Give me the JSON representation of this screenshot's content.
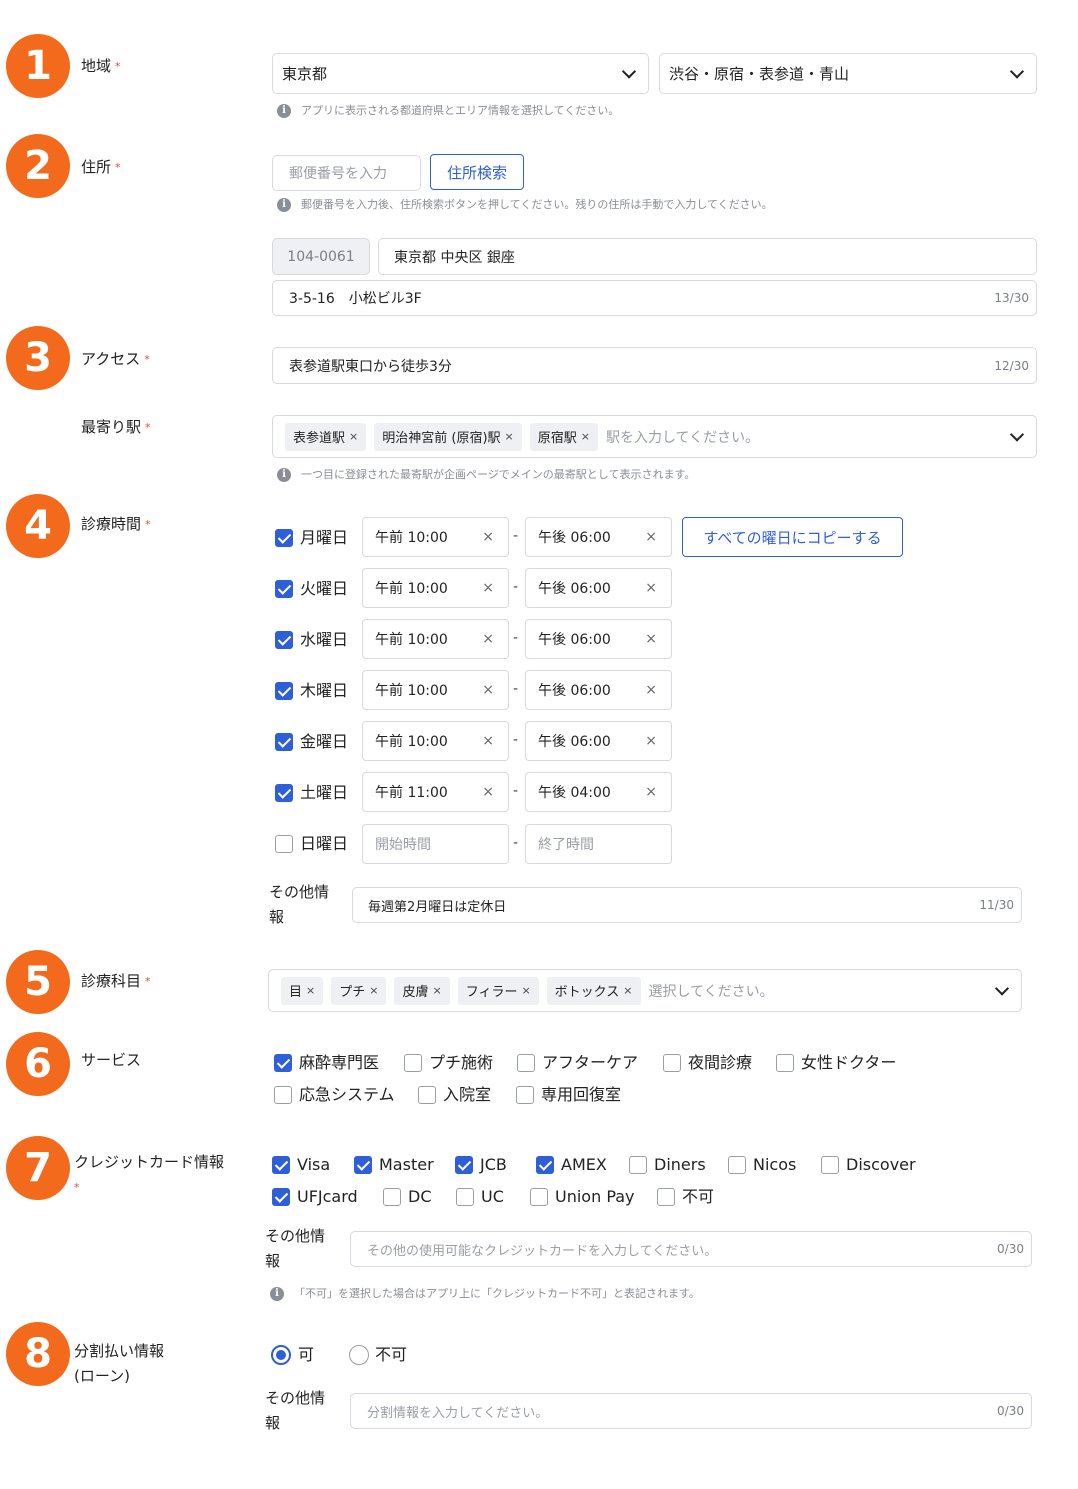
{
  "steps": [
    "1",
    "2",
    "3",
    "4",
    "5",
    "6",
    "7",
    "8"
  ],
  "required_mark": "*",
  "region": {
    "label": "地域",
    "prefecture": "東京都",
    "area": "渋谷・原宿・表参道・青山",
    "help": "アプリに表示される都道府県とエリア情報を選択してください。"
  },
  "address": {
    "label": "住所",
    "zip_placeholder": "郵便番号を入力",
    "search_button": "住所検索",
    "help": "郵便番号を入力後、住所検索ボタンを押してください。残りの住所は手動で入力してください。",
    "zip_value": "104-0061",
    "line1": "東京都 中央区 銀座",
    "line2": "3-5-16　小松ビル3F",
    "line2_counter": "13/30"
  },
  "access": {
    "label": "アクセス",
    "value": "表参道駅東口から徒歩3分",
    "counter": "12/30"
  },
  "station": {
    "label": "最寄り駅",
    "tags": [
      "表参道駅",
      "明治神宮前 (原宿)駅",
      "原宿駅"
    ],
    "placeholder": "駅を入力してください。",
    "help": "一つ目に登録された最寄駅が企画ページでメインの最寄駅として表示されます。"
  },
  "hours": {
    "label": "診療時間",
    "copy_button": "すべての曜日にコピーする",
    "days": [
      {
        "name": "月曜日",
        "checked": true,
        "start": "午前 10:00",
        "end": "午後 06:00"
      },
      {
        "name": "火曜日",
        "checked": true,
        "start": "午前 10:00",
        "end": "午後 06:00"
      },
      {
        "name": "水曜日",
        "checked": true,
        "start": "午前 10:00",
        "end": "午後 06:00"
      },
      {
        "name": "木曜日",
        "checked": true,
        "start": "午前 10:00",
        "end": "午後 06:00"
      },
      {
        "name": "金曜日",
        "checked": true,
        "start": "午前 10:00",
        "end": "午後 06:00"
      },
      {
        "name": "土曜日",
        "checked": true,
        "start": "午前 11:00",
        "end": "午後 04:00"
      },
      {
        "name": "日曜日",
        "checked": false,
        "start_placeholder": "開始時間",
        "end_placeholder": "終了時間"
      }
    ],
    "dash": "-",
    "clear": "×",
    "other_label_1": "その他情",
    "other_label_2": "報",
    "other_value": "毎週第2月曜日は定休日",
    "other_counter": "11/30"
  },
  "departments": {
    "label": "診療科目",
    "tags": [
      "目",
      "プチ",
      "皮膚",
      "フィラー",
      "ボトックス"
    ],
    "placeholder": "選択してください。"
  },
  "services": {
    "label": "サービス",
    "items": [
      {
        "name": "麻酔専門医",
        "checked": true
      },
      {
        "name": "プチ施術",
        "checked": false
      },
      {
        "name": "アフターケア",
        "checked": false
      },
      {
        "name": "夜間診療",
        "checked": false
      },
      {
        "name": "女性ドクター",
        "checked": false
      },
      {
        "name": "応急システム",
        "checked": false
      },
      {
        "name": "入院室",
        "checked": false
      },
      {
        "name": "専用回復室",
        "checked": false
      }
    ]
  },
  "credit": {
    "label": "クレジットカード情報",
    "items": [
      {
        "name": "Visa",
        "checked": true
      },
      {
        "name": "Master",
        "checked": true
      },
      {
        "name": "JCB",
        "checked": true
      },
      {
        "name": "AMEX",
        "checked": true
      },
      {
        "name": "Diners",
        "checked": false
      },
      {
        "name": "Nicos",
        "checked": false
      },
      {
        "name": "Discover",
        "checked": false
      },
      {
        "name": "UFJcard",
        "checked": true
      },
      {
        "name": "DC",
        "checked": false
      },
      {
        "name": "UC",
        "checked": false
      },
      {
        "name": "Union Pay",
        "checked": false
      },
      {
        "name": "不可",
        "checked": false
      }
    ],
    "other_label_1": "その他情",
    "other_label_2": "報",
    "other_placeholder": "その他の使用可能なクレジットカードを入力してください。",
    "other_counter": "0/30",
    "help": "「不可」を選択した場合はアプリ上に「クレジットカード不可」と表記されます。"
  },
  "installment": {
    "label_1": "分割払い情報",
    "label_2": "(ローン)",
    "option_yes": "可",
    "option_no": "不可",
    "selected": "可",
    "other_label_1": "その他情",
    "other_label_2": "報",
    "other_placeholder": "分割情報を入力してください。",
    "other_counter": "0/30"
  },
  "colors": {
    "step_badge": "#f46a1c",
    "accent": "#2f5fd6",
    "required": "#e04a3a"
  }
}
